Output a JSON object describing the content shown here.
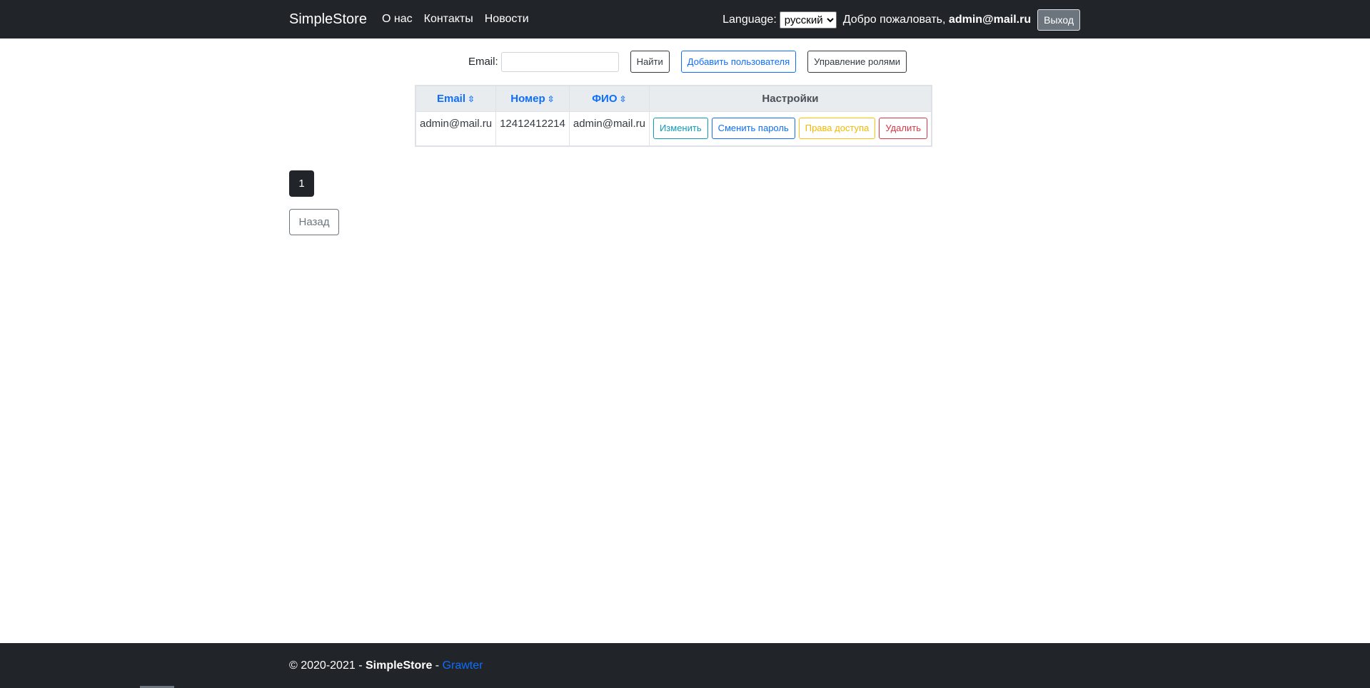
{
  "navbar": {
    "brand": "SimpleStore",
    "links": [
      "О нас",
      "Контакты",
      "Новости"
    ],
    "language_label": "Language:",
    "language_selected": "русский",
    "welcome_prefix": "Добро пожаловать,",
    "user_email": "admin@mail.ru",
    "logout_label": "Выход"
  },
  "search": {
    "label": "Email:",
    "value": "",
    "find_label": "Найти",
    "add_user_label": "Добавить пользователя",
    "manage_roles_label": "Управление ролями"
  },
  "table": {
    "headers": {
      "email": "Email",
      "number": "Номер",
      "name": "ФИО",
      "settings": "Настройки"
    },
    "sort_icon": "⇳",
    "rows": [
      {
        "email": "admin@mail.ru",
        "number": "12412412214",
        "name": "admin@mail.ru"
      }
    ],
    "actions": {
      "edit": "Изменить",
      "change_password": "Сменить пароль",
      "access_rights": "Права доступа",
      "delete": "Удалить"
    }
  },
  "pagination": {
    "current_page": "1",
    "back_label": "Назад"
  },
  "footer": {
    "copyright": "© 2020-2021 -",
    "brand": "SimpleStore",
    "separator": "-",
    "link": "Grawter"
  },
  "colors": {
    "navbar_bg": "#212529",
    "link_blue": "#0d6efd",
    "table_header_bg": "#e9ecef"
  }
}
